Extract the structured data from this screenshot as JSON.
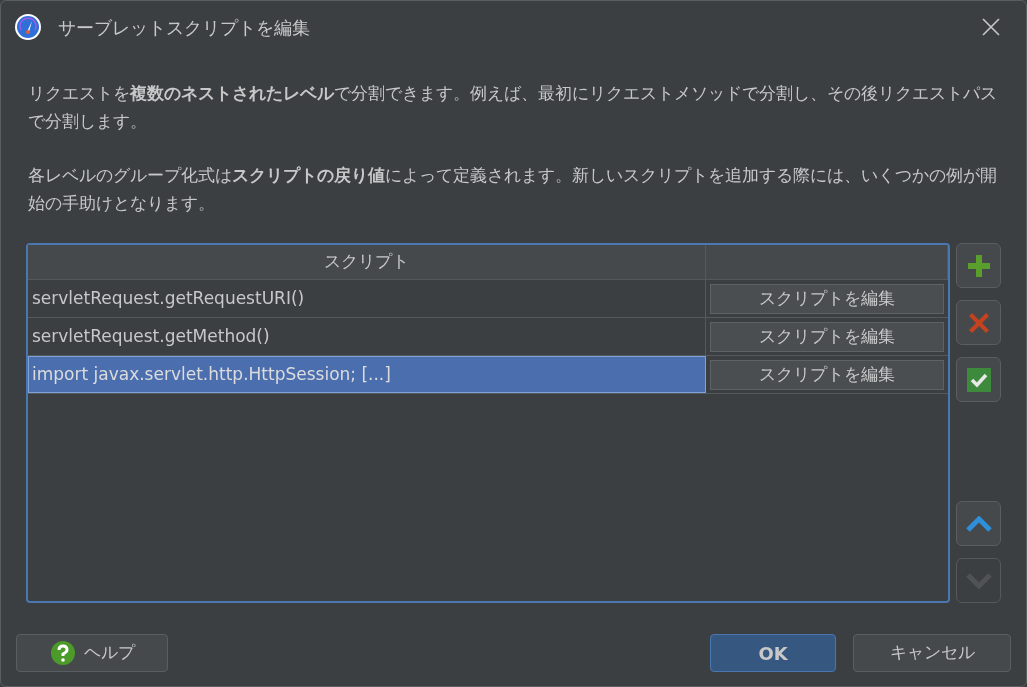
{
  "window": {
    "title": "サーブレットスクリプトを編集"
  },
  "description": [
    "リクエストを**複数のネストされたレベル**で分割できます。例えば、最初にリクエストメソッドで分割し、その後リクエストパスで分割します。",
    "各レベルのグループ化式は**スクリプトの戻り値**によって定義されます。新しいスクリプトを追加する際には、いくつかの例が開始の手助けとなります。"
  ],
  "table": {
    "columns": [
      "スクリプト"
    ],
    "rows": [
      {
        "script": "servletRequest.getRequestURI()",
        "action": "スクリプトを編集",
        "selected": false
      },
      {
        "script": "servletRequest.getMethod()",
        "action": "スクリプトを編集",
        "selected": false
      },
      {
        "script": "import javax.servlet.http.HttpSession; [...]",
        "action": "スクリプトを編集",
        "selected": true
      }
    ]
  },
  "side_buttons": [
    {
      "kind": "add",
      "disabled": false
    },
    {
      "kind": "remove",
      "disabled": false
    },
    {
      "kind": "check",
      "disabled": false
    },
    {
      "kind": "up",
      "disabled": false
    },
    {
      "kind": "down",
      "disabled": true
    }
  ],
  "footer": {
    "help": "ヘルプ",
    "ok": "OK",
    "cancel": "キャンセル"
  }
}
